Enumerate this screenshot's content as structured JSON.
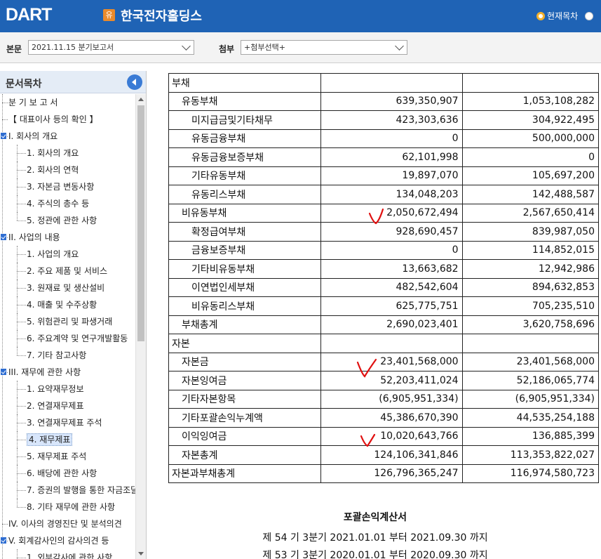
{
  "header": {
    "logo_text": "DART",
    "company_badge": "유",
    "company_name": "한국전자홀딩스",
    "view_option": "현재목차"
  },
  "selectors": {
    "main_label": "본문",
    "main_value": "2021.11.15  분기보고서",
    "attach_label": "첨부",
    "attach_value": "+첨부선택+"
  },
  "toc": {
    "title": "문서목차",
    "items": [
      {
        "label": "분 기 보 고 서",
        "level": 0,
        "checked": false
      },
      {
        "label": "【 대표이사 등의 확인 】",
        "level": 0,
        "checked": false
      },
      {
        "label": "I. 회사의 개요",
        "level": 0,
        "checked": true
      },
      {
        "label": "1. 회사의 개요",
        "level": 1
      },
      {
        "label": "2. 회사의 연혁",
        "level": 1
      },
      {
        "label": "3. 자본금 변동사항",
        "level": 1
      },
      {
        "label": "4. 주식의 총수 등",
        "level": 1
      },
      {
        "label": "5. 정관에 관한 사항",
        "level": 1,
        "last": true
      },
      {
        "label": "II. 사업의 내용",
        "level": 0,
        "checked": true
      },
      {
        "label": "1. 사업의 개요",
        "level": 1
      },
      {
        "label": "2. 주요 제품 및 서비스",
        "level": 1
      },
      {
        "label": "3. 원재료 및 생산설비",
        "level": 1
      },
      {
        "label": "4. 매출 및 수주상황",
        "level": 1
      },
      {
        "label": "5. 위험관리 및 파생거래",
        "level": 1
      },
      {
        "label": "6. 주요계약 및 연구개발활동",
        "level": 1
      },
      {
        "label": "7. 기타 참고사항",
        "level": 1,
        "last": true
      },
      {
        "label": "III. 재무에 관한 사항",
        "level": 0,
        "checked": true
      },
      {
        "label": "1. 요약재무정보",
        "level": 1
      },
      {
        "label": "2. 연결재무제표",
        "level": 1
      },
      {
        "label": "3. 연결재무제표 주석",
        "level": 1
      },
      {
        "label": "4. 재무제표",
        "level": 1,
        "active": true
      },
      {
        "label": "5. 재무제표 주석",
        "level": 1
      },
      {
        "label": "6. 배당에 관한 사항",
        "level": 1
      },
      {
        "label": "7. 증권의 발행을 통한 자금조달",
        "level": 1
      },
      {
        "label": "8. 기타 재무에 관한 사항",
        "level": 1,
        "last": true
      },
      {
        "label": "IV. 이사의 경영진단 및 분석의견",
        "level": 0,
        "checked": false
      },
      {
        "label": "V. 회계감사인의 감사의견 등",
        "level": 0,
        "checked": true
      },
      {
        "label": "1. 외부감사에 관한 사항",
        "level": 1
      }
    ]
  },
  "balance_rows": [
    {
      "label": "부채",
      "indent": 0,
      "a": "",
      "b": ""
    },
    {
      "label": "유동부채",
      "indent": 1,
      "a": "639,350,907",
      "b": "1,053,108,282"
    },
    {
      "label": "미지급금및기타채무",
      "indent": 2,
      "a": "423,303,636",
      "b": "304,922,495"
    },
    {
      "label": "유동금융부채",
      "indent": 2,
      "a": "0",
      "b": "500,000,000"
    },
    {
      "label": "유동금융보증부채",
      "indent": 2,
      "a": "62,101,998",
      "b": "0"
    },
    {
      "label": "기타유동부채",
      "indent": 2,
      "a": "19,897,070",
      "b": "105,697,200"
    },
    {
      "label": "유동리스부채",
      "indent": 2,
      "a": "134,048,203",
      "b": "142,488,587"
    },
    {
      "label": "비유동부채",
      "indent": 1,
      "a": "2,050,672,494",
      "b": "2,567,650,414"
    },
    {
      "label": "확정급여부채",
      "indent": 2,
      "a": "928,690,457",
      "b": "839,987,050"
    },
    {
      "label": "금융보증부채",
      "indent": 2,
      "a": "0",
      "b": "114,852,015"
    },
    {
      "label": "기타비유동부채",
      "indent": 2,
      "a": "13,663,682",
      "b": "12,942,986"
    },
    {
      "label": "이연법인세부채",
      "indent": 2,
      "a": "482,542,604",
      "b": "894,632,853"
    },
    {
      "label": "비유동리스부채",
      "indent": 2,
      "a": "625,775,751",
      "b": "705,235,510"
    },
    {
      "label": "부채총계",
      "indent": 1,
      "a": "2,690,023,401",
      "b": "3,620,758,696"
    },
    {
      "label": "자본",
      "indent": 0,
      "a": "",
      "b": ""
    },
    {
      "label": "자본금",
      "indent": 1,
      "a": "23,401,568,000",
      "b": "23,401,568,000"
    },
    {
      "label": "자본잉여금",
      "indent": 1,
      "a": "52,203,411,024",
      "b": "52,186,065,774"
    },
    {
      "label": "기타자본항목",
      "indent": 1,
      "a": "(6,905,951,334)",
      "b": "(6,905,951,334)"
    },
    {
      "label": "기타포괄손익누계액",
      "indent": 1,
      "a": "45,386,670,390",
      "b": "44,535,254,188"
    },
    {
      "label": "이익잉여금",
      "indent": 1,
      "a": "10,020,643,766",
      "b": "136,885,399"
    },
    {
      "label": "자본총계",
      "indent": 1,
      "a": "124,106,341,846",
      "b": "113,353,822,027"
    },
    {
      "label": "자본과부채총계",
      "indent": 0,
      "a": "126,796,365,247",
      "b": "116,974,580,723"
    }
  ],
  "statement": {
    "title": "포괄손익계산서",
    "period_current": "제 54 기 3분기 2021.01.01 부터 2021.09.30 까지",
    "period_prior": "제 53 기 3분기 2020.01.01 부터 2020.09.30 까지"
  },
  "colors": {
    "header_bg": "#1f63b5",
    "accent_orange": "#e98a2c",
    "annotation_red": "#e01010"
  }
}
